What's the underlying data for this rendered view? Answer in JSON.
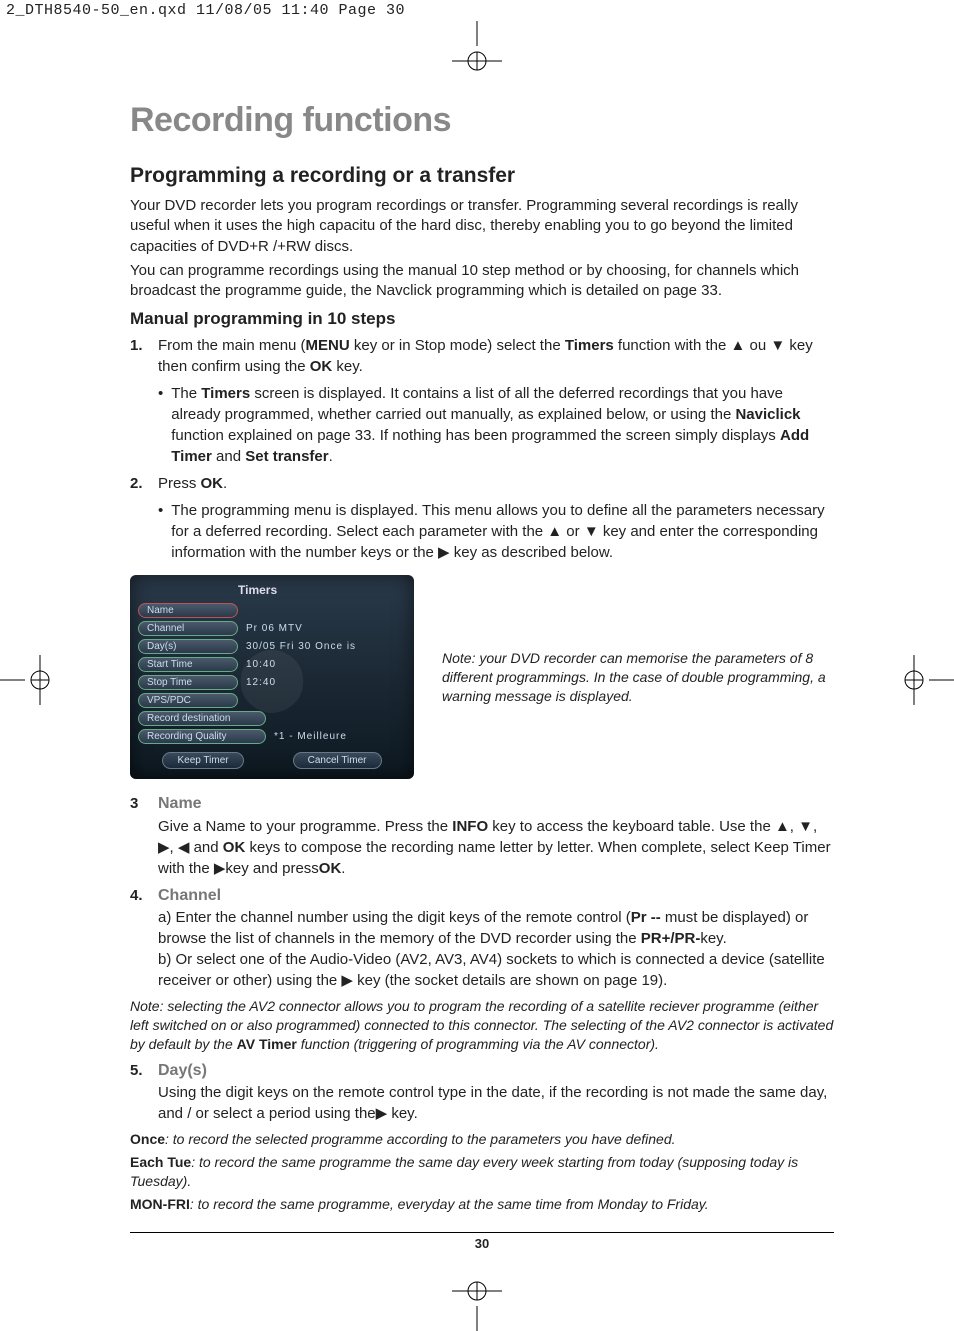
{
  "print_header": "2_DTH8540-50_en.qxd  11/08/05  11:40  Page 30",
  "title": "Recording functions",
  "section_heading": "Programming a recording or a transfer",
  "intro_p1": "Your DVD recorder lets you program recordings or transfer. Programming several recordings is really useful when it uses the high capacitu of the hard disc, thereby enabling you to go beyond the limited capacities of DVD+R /+RW discs.",
  "intro_p2": "You can programme recordings using the manual 10 step method or by choosing, for channels which broadcast the programme guide, the Navclick programming which is detailed on page 33.",
  "subsection_heading": "Manual programming in 10 steps",
  "step1": {
    "num": "1.",
    "prefix": "From the main menu (",
    "menu_key": "MENU",
    "mid1": " key or in Stop mode) select the ",
    "timers": "Timers",
    "mid2": " function with the ▲ ou ▼ key then confirm using the ",
    "ok": "OK",
    "suffix": " key.",
    "bullet_prefix": "The ",
    "bullet_timers": "Timers",
    "bullet_mid": " screen is displayed.  It contains a list of all the deferred recordings that you have already programmed, whether carried out manually, as explained below, or using the ",
    "bullet_naviclick": "Naviclick",
    "bullet_mid2": " function explained on page 33. If nothing has been programmed the screen simply displays ",
    "bullet_add": "Add Timer",
    "bullet_and": " and ",
    "bullet_set": "Set transfer",
    "bullet_end": "."
  },
  "step2": {
    "num": "2.",
    "text_pre": "Press ",
    "ok": "OK",
    "text_post": ".",
    "bullet": "The programming menu is displayed. This menu allows you to define all the parameters necessary for a deferred recording. Select each parameter with the ▲ or ▼ key and enter the corresponding information with the number keys or the ▶ key as described below."
  },
  "timers_ui": {
    "title": "Timers",
    "rows": [
      {
        "label": "Name",
        "value": ""
      },
      {
        "label": "Channel",
        "value": "Pr 06   MTV"
      },
      {
        "label": "Day(s)",
        "value": "30/05  Fri  30  Once  is"
      },
      {
        "label": "Start Time",
        "value": "10:40"
      },
      {
        "label": "Stop Time",
        "value": "12:40"
      },
      {
        "label": "VPS/PDC",
        "value": ""
      },
      {
        "label": "Record destination",
        "value": ""
      },
      {
        "label": "Recording Quality",
        "value": "*1 - Meilleure"
      }
    ],
    "btn_keep": "Keep Timer",
    "btn_cancel": "Cancel Timer"
  },
  "figure_note": "Note: your DVD recorder can memorise the parameters of 8 different programmings. In the case of double programming, a warning message is displayed.",
  "step3": {
    "num": "3",
    "label": "Name",
    "body_pre": "Give a Name to your programme. Press the ",
    "info": "INFO",
    "body_mid": " key to access the keyboard table. Use the ▲, ▼, ▶, ◀ and ",
    "ok": "OK",
    "body_mid2": " keys to compose the recording name letter by letter. When complete, select Keep Timer with the ▶key and press",
    "ok2": "OK",
    "body_end": "."
  },
  "step4": {
    "num": "4.",
    "label": "Channel",
    "a_pre": "a) Enter the channel number using the digit keys of the remote control (",
    "a_pr": "Pr --",
    "a_mid": " must be displayed) or browse the list of channels in the memory of the DVD recorder using the ",
    "a_prkey": "PR+/PR-",
    "a_end": "key.",
    "b": "b) Or select one of the Audio-Video (AV2, AV3, AV4) sockets to which is connected a device (satellite receiver or other) using the ▶ key (the socket details are shown on page 19).",
    "note_pre": "Note: selecting the AV2 connector allows you to program the recording of a satellite reciever programme (either left switched on or also programmed) connected to this connector. The selecting of the AV2 connector is activated by default by the ",
    "note_av": "AV Timer",
    "note_post": " function (triggering of programming via the AV connector)."
  },
  "step5": {
    "num": "5.",
    "label": "Day(s)",
    "body": "Using the digit keys on the remote control type in the date, if the recording is not made the same day, and / or select a period using the▶ key.",
    "once_label": "Once",
    "once_text": ": to record the selected programme according to the parameters you have defined.",
    "each_label": "Each Tue",
    "each_text": ": to record the same programme the same day every week starting from today (supposing today is Tuesday).",
    "mon_label": "MON-FRI",
    "mon_text": ": to record the same programme, everyday at the same time from Monday to Friday."
  },
  "page_number": "30"
}
